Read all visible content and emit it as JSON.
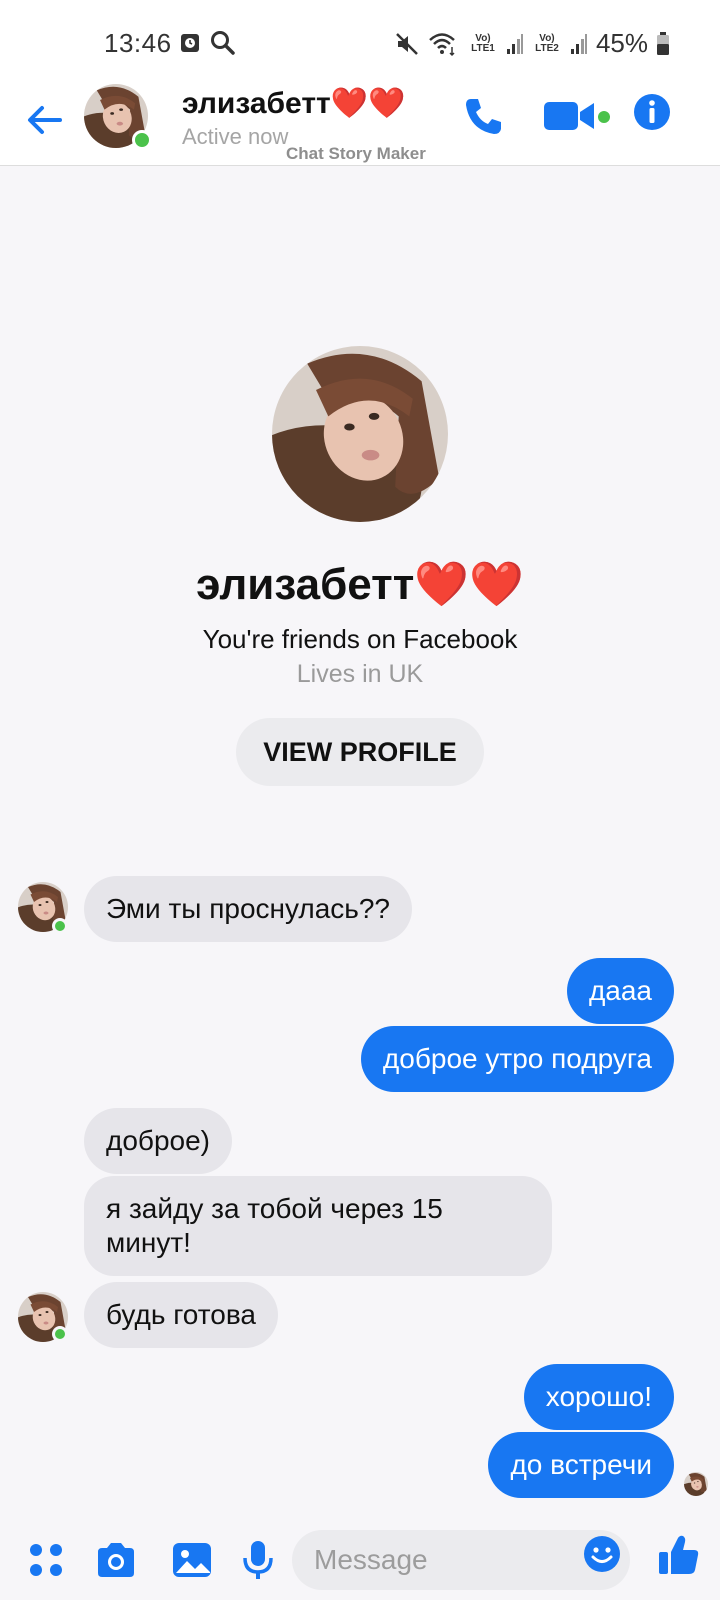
{
  "status_bar": {
    "time": "13:46",
    "battery": "45%",
    "sim1": "Vo) LTE1",
    "sim2": "Vo) LTE2",
    "icons": [
      "alarm-icon",
      "search-icon",
      "mute-icon",
      "wifi-icon",
      "signal-icon",
      "battery-icon"
    ]
  },
  "header": {
    "name": "элизабетт❤️❤️",
    "status": "Active now",
    "watermark": "Chat Story Maker",
    "accent": "#1877f2",
    "online_color": "#4bc24b"
  },
  "profile": {
    "name": "элизабетт❤️❤️",
    "friends_text": "You're friends on Facebook",
    "lives_text": "Lives in UK",
    "view_profile_label": "VIEW PROFILE"
  },
  "messages": [
    {
      "side": "in",
      "text": "Эми ты проснулась??"
    },
    {
      "side": "out",
      "text": "дааа"
    },
    {
      "side": "out",
      "text": "доброе утро подруга"
    },
    {
      "side": "in",
      "text": "доброе)"
    },
    {
      "side": "in",
      "text": "я зайду за тобой через 15 минут!"
    },
    {
      "side": "in",
      "text": "будь готова"
    },
    {
      "side": "out",
      "text": "хорошо!"
    },
    {
      "side": "out",
      "text": "до встречи"
    }
  ],
  "composer": {
    "placeholder": "Message",
    "icons": [
      "menu-dots-icon",
      "camera-icon",
      "gallery-icon",
      "microphone-icon",
      "emoji-icon",
      "thumbs-up-icon"
    ]
  }
}
